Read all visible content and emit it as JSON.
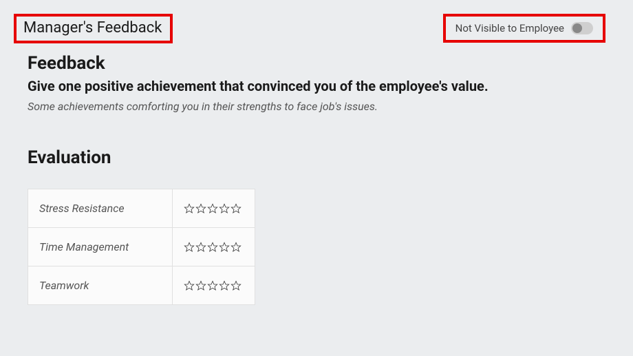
{
  "header": {
    "title": "Manager's Feedback",
    "visibility_label": "Not Visible to Employee",
    "toggle_state": "off"
  },
  "feedback": {
    "section_title": "Feedback",
    "question": "Give one positive achievement that convinced you of the employee's value.",
    "hint": "Some achievements comforting you in their strengths to face job's issues."
  },
  "evaluation": {
    "section_title": "Evaluation",
    "rows": [
      {
        "label": "Stress Resistance",
        "rating": 0
      },
      {
        "label": "Time Management",
        "rating": 0
      },
      {
        "label": "Teamwork",
        "rating": 0
      }
    ]
  }
}
